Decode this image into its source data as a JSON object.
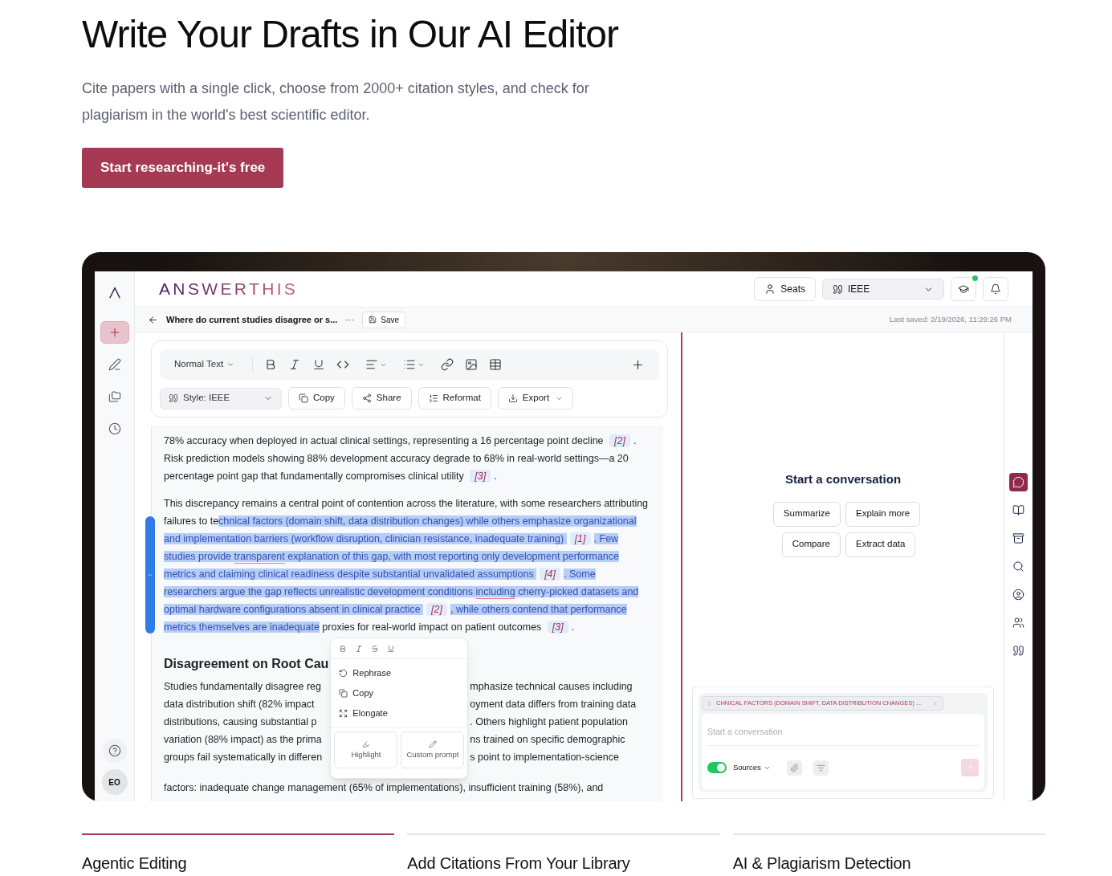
{
  "hero": {
    "title": "Write Your Drafts in Our AI Editor",
    "subtitle": "Cite papers with a single click, choose from 2000+ citation styles, and check for plagiarism in the world's best scientific editor.",
    "cta": "Start researching-it's free"
  },
  "app": {
    "logo": "ANSWERTHIS",
    "left_rail": {
      "items": [
        {
          "kind": "new",
          "selected": true
        },
        {
          "kind": "edit",
          "selected": false
        },
        {
          "kind": "folders",
          "selected": false
        },
        {
          "kind": "history",
          "selected": false
        }
      ],
      "avatar": "EO"
    },
    "header": {
      "seats": "Seats",
      "style_select": "IEEE",
      "notification_dot": true
    },
    "document": {
      "title": "Where do current studies disagree or s...",
      "more": "···",
      "save": "Save",
      "last_saved": "Last saved: 2/19/2026, 11:29:26 PM"
    },
    "toolbar": {
      "text_style": "Normal Text",
      "citation_style": "Style: IEEE",
      "actions": [
        {
          "label": "Copy",
          "kind": "copy"
        },
        {
          "label": "Share",
          "kind": "share"
        },
        {
          "label": "Reformat",
          "kind": "reformat"
        },
        {
          "label": "Export",
          "kind": "export"
        }
      ]
    },
    "paragraphs": [
      [
        {
          "kind": "text",
          "text": "78% accuracy when deployed in actual clinical settings, representing a 16 percentage point decline ",
          "selected": false
        },
        {
          "kind": "cite",
          "text": "[2]"
        },
        {
          "kind": "text",
          "text": ". Risk prediction models showing 88% development accuracy degrade to 68% in real-world settings—a 20 percentage point gap that fundamentally compromises clinical utility ",
          "selected": false
        },
        {
          "kind": "cite",
          "text": "[3]"
        },
        {
          "kind": "text",
          "text": ".",
          "selected": false
        }
      ],
      [
        {
          "kind": "text",
          "text": "This discrepancy remains a central point of contention across the literature, with some researchers attributing failures to te",
          "selected": false
        },
        {
          "kind": "text",
          "text": "chnical factors (domain shift, data distribution changes) while others emphasize organizational and implementation barriers (workflow disruption, clinician resistance, inadequate training) ",
          "selected": true
        },
        {
          "kind": "cite",
          "text": "[1]"
        },
        {
          "kind": "text",
          "text": ". Few studies provide ",
          "selected": true
        },
        {
          "kind": "flagged",
          "text": "transparent",
          "selected": true
        },
        {
          "kind": "text",
          "text": " explanation of this gap, with most reporting only development performance metrics and claiming clinical readiness despite substantial unvalidated assumptions ",
          "selected": true
        },
        {
          "kind": "cite",
          "text": "[4]"
        },
        {
          "kind": "text",
          "text": ". Some researchers argue the gap reflects unrealistic development conditions ",
          "selected": true
        },
        {
          "kind": "flagged",
          "text": "including",
          "selected": true
        },
        {
          "kind": "text",
          "text": " cherry-picked datasets and optimal hardware configurations absent in clinical practice ",
          "selected": true
        },
        {
          "kind": "cite",
          "text": "[2]"
        },
        {
          "kind": "text",
          "text": ", while others contend that performance metrics themselves are inadequate",
          "selected": true
        },
        {
          "kind": "text",
          "text": " proxies for real-world impact on patient outcomes ",
          "selected": false
        },
        {
          "kind": "cite",
          "text": "[3]"
        },
        {
          "kind": "text",
          "text": ".",
          "selected": false
        }
      ]
    ],
    "section": {
      "heading": "Disagreement on Root Cau",
      "left_lines": [
        "Studies fundamentally disagree reg",
        "data distribution shift (82% impact",
        "distributions, causing substantial p",
        "variation (88% impact) as the prima",
        "groups fail systematically in differen"
      ],
      "right_lines": [
        "mphasize technical causes including",
        "oyment data differs from training data",
        ". Others highlight patient population",
        "ns trained on specific demographic",
        "s point to implementation-science"
      ],
      "last_line": "factors: inadequate change management (65% of implementations), insufficient training (58%), and"
    },
    "popover": {
      "actions": [
        {
          "label": "Rephrase",
          "kind": "rephrase"
        },
        {
          "label": "Copy",
          "kind": "copy"
        },
        {
          "label": "Elongate",
          "kind": "elongate"
        }
      ],
      "buttons": [
        {
          "label": "Highlight",
          "kind": "highlight"
        },
        {
          "label": "Custom prompt",
          "kind": "custom"
        }
      ]
    },
    "chat": {
      "title": "Start a conversation",
      "suggestions": [
        "Summarize",
        "Explain more",
        "Compare",
        "Extract data"
      ],
      "context_chip": "CHNICAL FACTORS (DOMAIN SHIFT, DATA DISTRIBUTION CHANGES) ...",
      "placeholder": "Start a conversation",
      "sources": {
        "label": "Sources",
        "on": true
      }
    },
    "right_rail": {
      "items": [
        {
          "kind": "chat",
          "selected": true
        },
        {
          "kind": "book",
          "selected": false
        },
        {
          "kind": "archive",
          "selected": false
        },
        {
          "kind": "search",
          "selected": false
        },
        {
          "kind": "profile",
          "selected": false
        },
        {
          "kind": "users",
          "selected": false
        },
        {
          "kind": "quote",
          "selected": false
        }
      ]
    }
  },
  "features": [
    {
      "title": "Agentic Editing",
      "selected": true
    },
    {
      "title": "Add Citations From Your Library",
      "selected": false
    },
    {
      "title": "AI & Plagiarism Detection",
      "selected": false
    }
  ]
}
